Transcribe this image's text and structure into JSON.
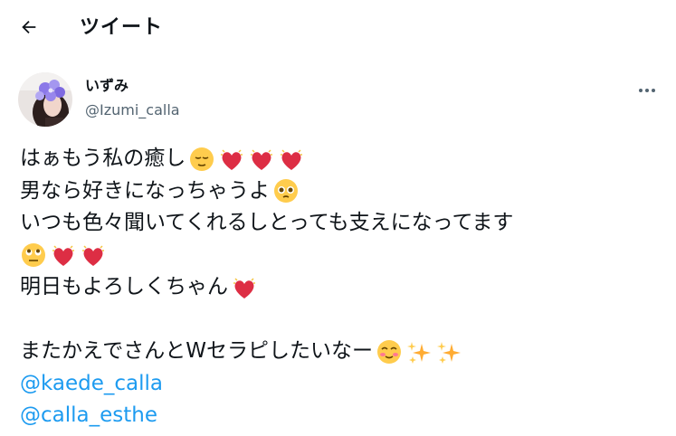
{
  "header": {
    "back_icon": "arrow-left-icon",
    "title": "ツイート"
  },
  "tweet": {
    "author": {
      "display_name": "いずみ",
      "handle": "@Izumi_calla",
      "avatar_icon": "profile-photo"
    },
    "more_icon": "more-dots-icon",
    "lines": {
      "l1": "はぁもう私の癒し",
      "l2": "男なら好きになっちゃうよ",
      "l3": "いつも色々聞いてくれるしとっても支えになってます",
      "l5": "明日もよろしくちゃん",
      "l7": "またかえでさんとWセラピしたいなー"
    },
    "mentions": [
      "@kaede_calla",
      "@calla_esthe"
    ],
    "emojis": {
      "relieved": "relieved-face-emoji",
      "heart_sparkle": "sparkling-heart-emoji",
      "pleading": "pleading-face-emoji",
      "eye_roll": "eye-roll-face-emoji",
      "smiling": "smiling-face-emoji",
      "sparkles": "sparkles-emoji"
    },
    "colors": {
      "mention": "#1d9bf0",
      "handle": "#536471",
      "text": "#0f1419"
    }
  }
}
